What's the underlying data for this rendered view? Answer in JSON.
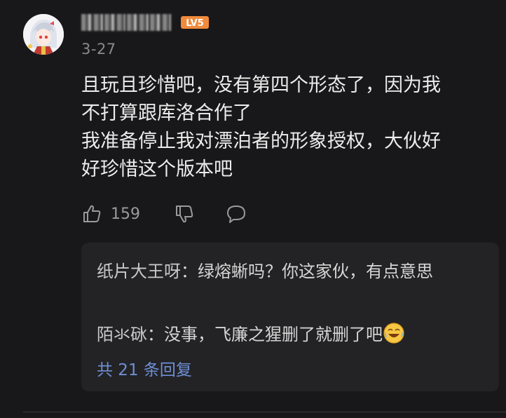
{
  "comment": {
    "level_badge": "LV5",
    "timestamp": "3-27",
    "content_lines": [
      "且玩且珍惜吧，没有第四个形态了，因为我",
      "不打算跟库洛合作了",
      "我准备停止我对漂泊者的形象授权，大伙好",
      "好珍惜这个版本吧"
    ],
    "like_count": "159",
    "icons": {
      "like": "thumbs-up-icon",
      "dislike": "thumbs-down-icon",
      "comment": "comment-bubble-icon"
    }
  },
  "replies": {
    "items": [
      {
        "author": "纸片大王呀",
        "separator": "：",
        "text": "绿熔蜥吗？你这家伙，有点意思"
      },
      {
        "author": "陌氺砯",
        "separator": "：",
        "text": "没事，飞廉之猩删了就删了吧",
        "emoji": "laughing-crying-emoji"
      }
    ],
    "more_label": "共 21 条回复"
  },
  "colors": {
    "background": "#18181a",
    "reply_background": "#232325",
    "text": "#ececec",
    "muted": "#8a8a8d",
    "link": "#6f8fd6",
    "level_badge": "#f08a3c"
  }
}
